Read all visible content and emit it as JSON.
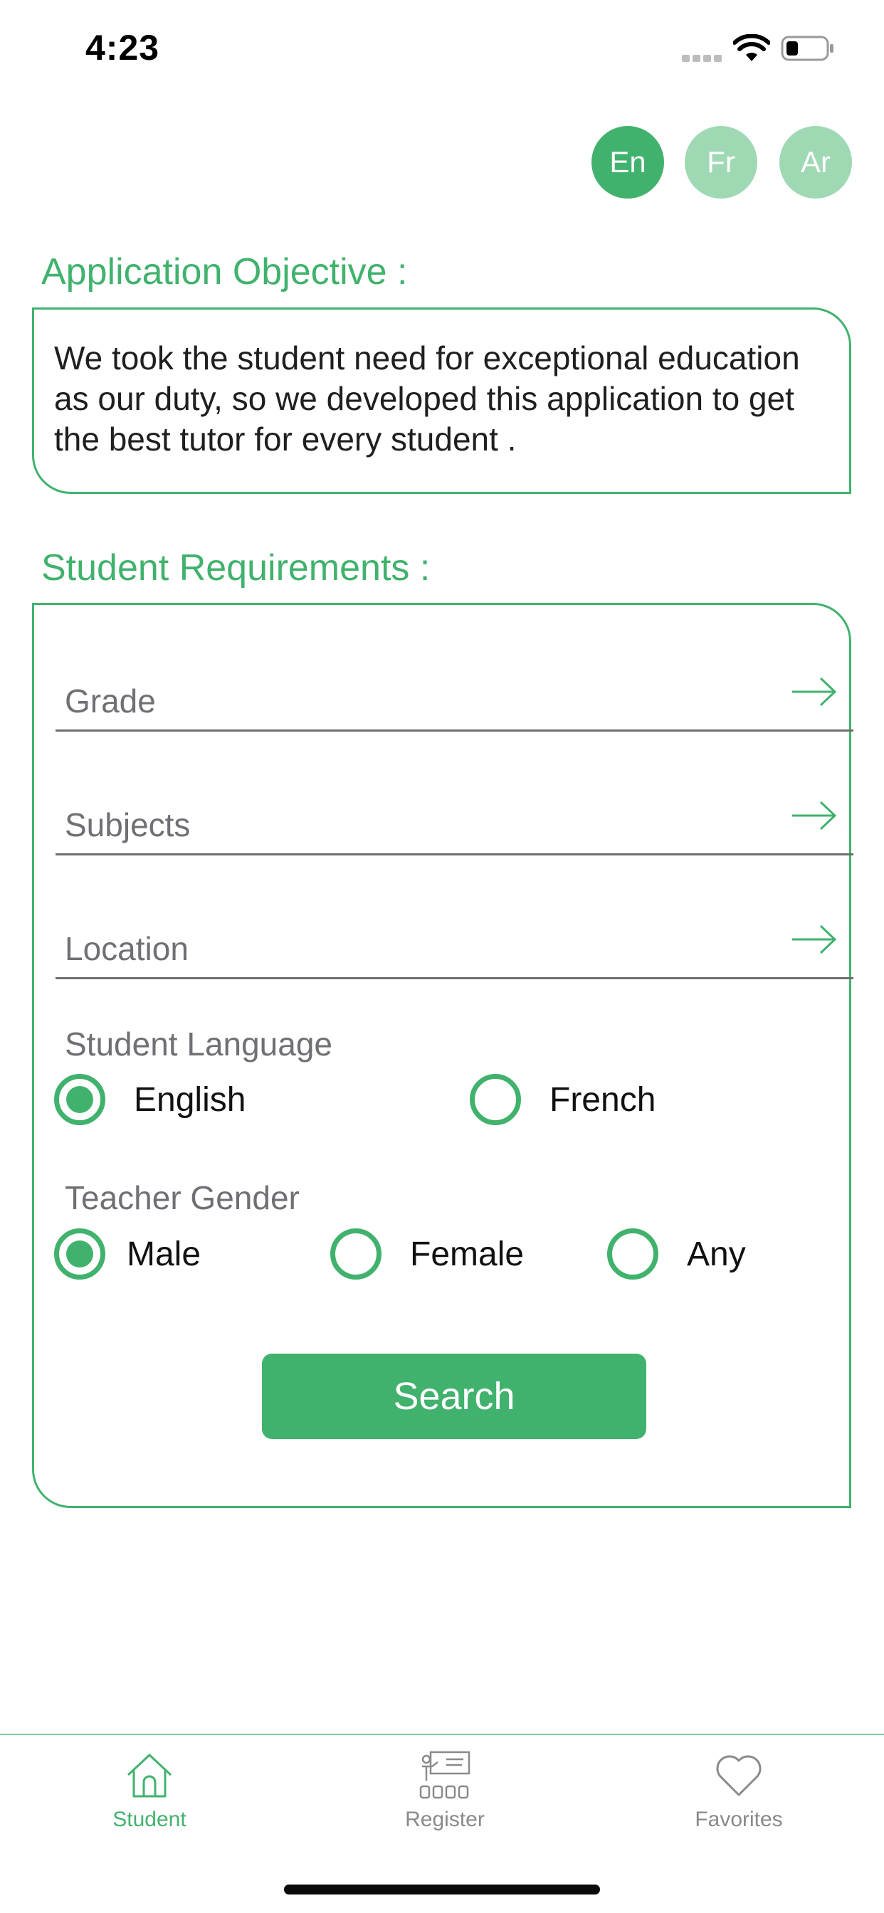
{
  "status_bar": {
    "time": "4:23"
  },
  "language_buttons": [
    {
      "label": "En",
      "selected": true
    },
    {
      "label": "Fr",
      "selected": false
    },
    {
      "label": "Ar",
      "selected": false
    }
  ],
  "objective": {
    "title": "Application Objective :",
    "text": "We took the student need for exceptional education as our duty, so we developed this application to get the best tutor for every student ."
  },
  "requirements": {
    "title": "Student Requirements :",
    "fields": [
      {
        "placeholder": "Grade",
        "icon": "arrow-right-icon"
      },
      {
        "placeholder": "Subjects",
        "icon": "arrow-right-icon"
      },
      {
        "placeholder": "Location",
        "icon": "arrow-right-icon"
      }
    ],
    "student_language": {
      "label": "Student Language",
      "options": [
        {
          "label": "English",
          "selected": true
        },
        {
          "label": "French",
          "selected": false
        }
      ]
    },
    "teacher_gender": {
      "label": "Teacher Gender",
      "options": [
        {
          "label": "Male",
          "selected": true
        },
        {
          "label": "Female",
          "selected": false
        },
        {
          "label": "Any",
          "selected": false
        }
      ]
    },
    "search_label": "Search"
  },
  "tab_bar": {
    "tabs": [
      {
        "label": "Student",
        "icon": "home-icon",
        "active": true
      },
      {
        "label": "Register",
        "icon": "teacher-icon",
        "active": false
      },
      {
        "label": "Favorites",
        "icon": "heart-icon",
        "active": false
      }
    ]
  },
  "colors": {
    "accent": "#41b26d",
    "accent_light": "#9fd9b4",
    "muted_text": "#6e7074"
  }
}
